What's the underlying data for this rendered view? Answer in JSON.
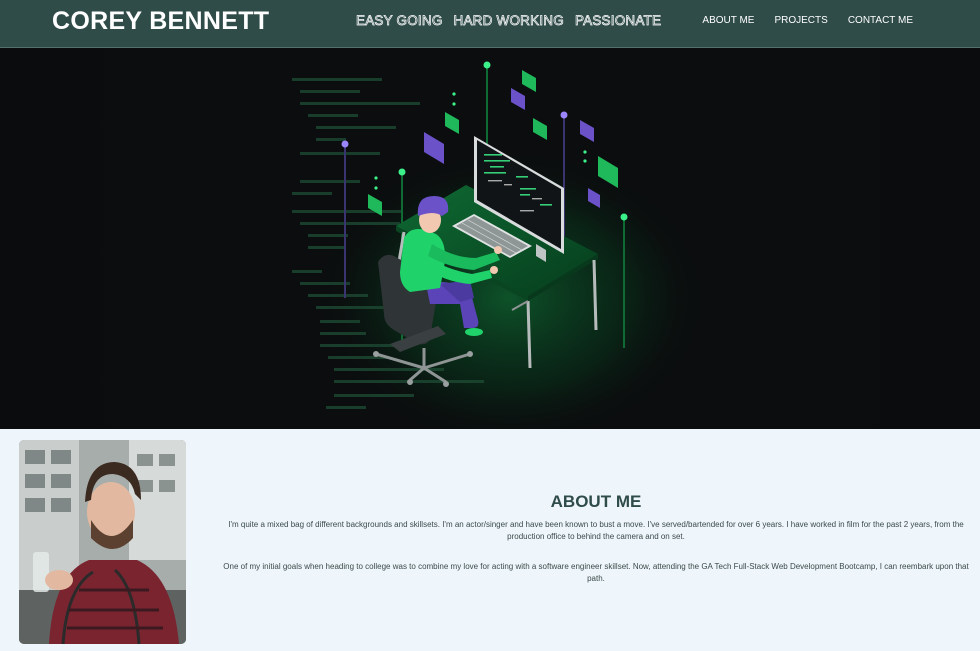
{
  "header": {
    "brand": "COREY BENNETT",
    "taglines": [
      "EASY GOING",
      "HARD WORKING",
      "PASSIONATE"
    ],
    "nav": [
      "ABOUT ME",
      "PROJECTS",
      "CONTACT ME"
    ]
  },
  "about": {
    "title": "ABOUT ME",
    "paragraphs": [
      "I'm quite a mixed bag of different backgrounds and skillsets. I'm an actor/singer and have been known to bust a move. I've served/bartended for over 6 years. I have worked in film for the past 2 years, from the production office to behind the camera and on set.",
      "One of my initial goals when heading to college was to combine my love for acting with a software engineer skillset. Now, attending the GA Tech Full-Stack Web Development Bootcamp, I can reembark upon that path."
    ]
  },
  "colors": {
    "header_bg": "#2f4c49",
    "about_bg": "#eef6fb",
    "accent_green": "#1fd36a",
    "accent_purple": "#6b52c9"
  }
}
